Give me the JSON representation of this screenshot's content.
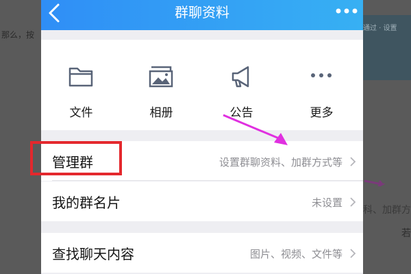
{
  "background": {
    "left_text": "那么，按",
    "right_label": "通过 · 设置",
    "right_text": "科、加群方",
    "right_edge": "若"
  },
  "header": {
    "title": "群聊资料",
    "back_icon": "chevron-left-icon",
    "menu_icon": "more-dots-icon"
  },
  "grid": [
    {
      "label": "文件",
      "icon": "folder-icon"
    },
    {
      "label": "相册",
      "icon": "photo-album-icon"
    },
    {
      "label": "公告",
      "icon": "megaphone-icon"
    },
    {
      "label": "更多",
      "icon": "more-dots-icon"
    }
  ],
  "rows": [
    {
      "label": "管理群",
      "value": "设置群聊资料、加群方式等"
    },
    {
      "label": "我的群名片",
      "value": "未设置"
    },
    {
      "label": "查找聊天内容",
      "value": "图片、视频、文件等"
    }
  ],
  "colors": {
    "header_start": "#2f8ef6",
    "header_end": "#37b0f3",
    "highlight": "#e4282d",
    "arrow": "#e030e0"
  }
}
